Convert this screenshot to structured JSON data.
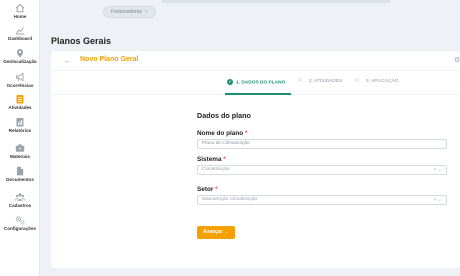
{
  "sidebar": {
    "items": [
      {
        "label": "Home",
        "icon": "home-icon"
      },
      {
        "label": "Dashboard",
        "icon": "dashboard-icon"
      },
      {
        "label": "Geolocalização",
        "icon": "location-pin-icon"
      },
      {
        "label": "Ocorrências",
        "icon": "megaphone-icon"
      },
      {
        "label": "Atividades",
        "icon": "clipboard-icon"
      },
      {
        "label": "Relatórios",
        "icon": "report-icon"
      },
      {
        "label": "Materiais",
        "icon": "tools-icon"
      },
      {
        "label": "Documentos",
        "icon": "document-icon"
      },
      {
        "label": "Cadastros",
        "icon": "users-icon"
      },
      {
        "label": "Configurações",
        "icon": "gears-icon"
      }
    ],
    "active_index": 4,
    "accent_color": "#f4a100"
  },
  "topbar": {
    "chip_label": "Fornecedores",
    "chip_close": "×"
  },
  "page": {
    "title": "Planos Gerais"
  },
  "card": {
    "back_glyph": "←",
    "title": "Novo Plano Geral",
    "settings_glyph": "⚙"
  },
  "stepper": {
    "steps": [
      {
        "label": "1. DADOS DO PLANO",
        "state": "active"
      },
      {
        "label": "2. ATIVIDADES",
        "state": "pending"
      },
      {
        "label": "3. APLICAÇÃO",
        "state": "pending"
      }
    ],
    "separator": ">",
    "check_glyph": "✓",
    "active_color": "#1e8f6e"
  },
  "form": {
    "heading": "Dados do plano",
    "required_mark": "*",
    "fields": {
      "name": {
        "label": "Nome do plano",
        "placeholder": "Plano de Climatização"
      },
      "system": {
        "label": "Sistema",
        "value": "Climatização",
        "controls": "× ⌄"
      },
      "sector": {
        "label": "Setor",
        "value": "Manutenção Climatização",
        "controls": "× ⌄"
      }
    },
    "next_button": "Avançar →"
  }
}
